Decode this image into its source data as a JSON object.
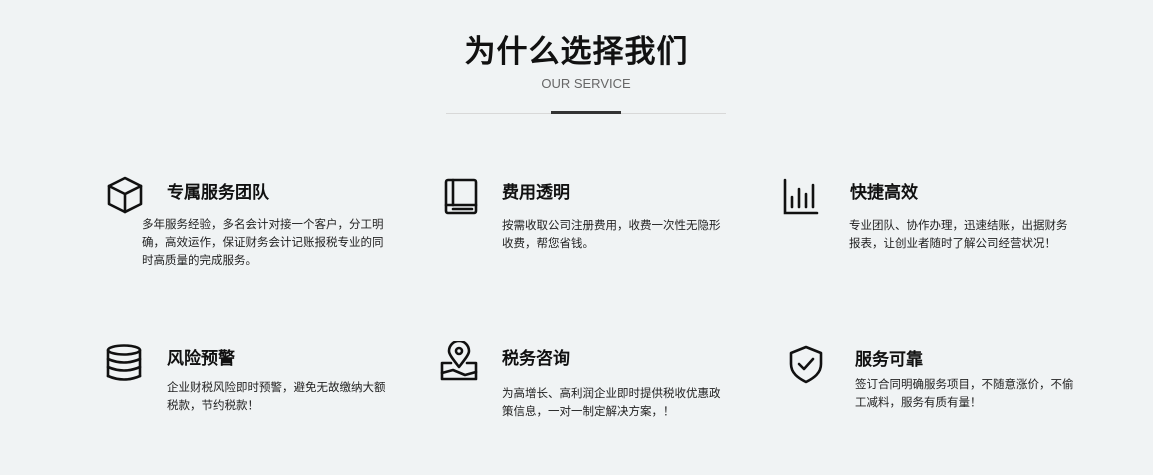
{
  "header": {
    "title": "为什么选择我们",
    "subtitle": "OUR SERVICE"
  },
  "features": [
    {
      "icon": "cube-icon",
      "title": "专属服务团队",
      "description": "多年服务经验，多名会计对接一个客户，分工明确，高效运作，保证财务会计记账报税专业的同时高质量的完成服务。"
    },
    {
      "icon": "book-icon",
      "title": "费用透明",
      "description": "按需收取公司注册费用，收费一次性无隐形收费，帮您省钱。"
    },
    {
      "icon": "bar-chart-icon",
      "title": "快捷高效",
      "description": "专业团队、协作办理，迅速结账，出据财务报表，让创业者随时了解公司经营状况！"
    },
    {
      "icon": "coins-icon",
      "title": "风险预警",
      "description": "企业财税风险即时预警，避免无故缴纳大额税款，节约税款！"
    },
    {
      "icon": "map-pin-icon",
      "title": "税务咨询",
      "description": "为高增长、高利润企业即时提供税收优惠政策信息，一对一制定解决方案，！"
    },
    {
      "icon": "shield-check-icon",
      "title": "服务可靠",
      "description": "签订合同明确服务项目，不随意涨价，不偷工减料，服务有质有量！"
    }
  ]
}
